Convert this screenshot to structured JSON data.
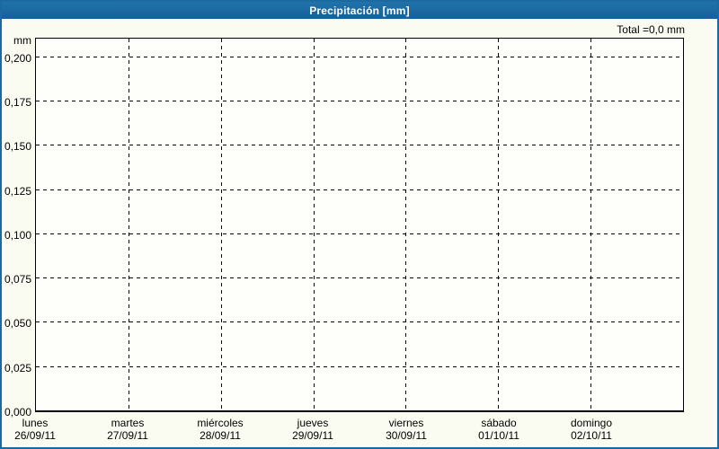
{
  "window": {
    "title": "Precipitación [mm]",
    "accent_color": "#1b68a0",
    "border_color": "#1c69a0",
    "background_color": "#fbfcf1"
  },
  "summary": {
    "total_label": "Total =0,0 mm",
    "total_value_mm": 0.0
  },
  "chart_data": {
    "type": "bar",
    "title": "Precipitación [mm]",
    "ylabel": "mm",
    "xlabel": "",
    "ylim": [
      0,
      0.21
    ],
    "grid": "dashed",
    "legend": "none",
    "y_tick_values": [
      0.2,
      0.175,
      0.15,
      0.125,
      0.1,
      0.075,
      0.05,
      0.025,
      0.0
    ],
    "y_tick_labels": [
      "0,200",
      "0,175",
      "0,150",
      "0,125",
      "0,100",
      "0,075",
      "0,050",
      "0,025",
      "0,000"
    ],
    "categories": [
      {
        "day": "lunes",
        "date": "26/09/11"
      },
      {
        "day": "martes",
        "date": "27/09/11"
      },
      {
        "day": "miércoles",
        "date": "28/09/11"
      },
      {
        "day": "jueves",
        "date": "29/09/11"
      },
      {
        "day": "viernes",
        "date": "30/09/11"
      },
      {
        "day": "sábado",
        "date": "01/10/11"
      },
      {
        "day": "domingo",
        "date": "02/10/11"
      }
    ],
    "values": [
      0,
      0,
      0,
      0,
      0,
      0,
      0
    ],
    "total_mm": 0.0,
    "gridline_color": "#000000"
  }
}
